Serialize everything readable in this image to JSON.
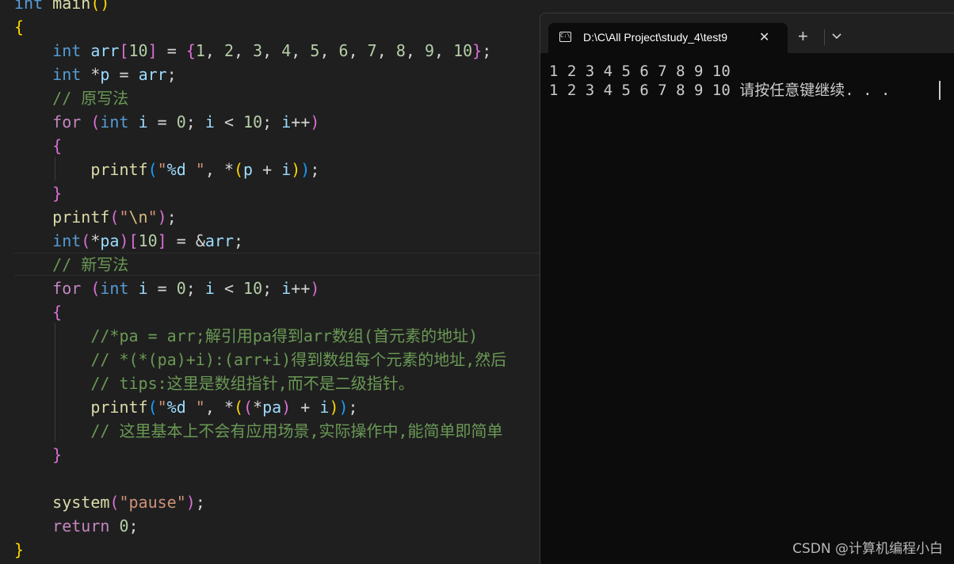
{
  "editor": {
    "lines": [
      [
        {
          "c": "kw",
          "t": "int"
        },
        {
          "t": " "
        },
        {
          "c": "fn",
          "t": "main"
        },
        {
          "c": "b1",
          "t": "()"
        }
      ],
      [
        {
          "c": "b1",
          "t": "{"
        }
      ],
      [
        {
          "t": "    "
        },
        {
          "c": "kw",
          "t": "int"
        },
        {
          "t": " "
        },
        {
          "c": "var",
          "t": "arr"
        },
        {
          "c": "b2",
          "t": "["
        },
        {
          "c": "num",
          "t": "10"
        },
        {
          "c": "b2",
          "t": "]"
        },
        {
          "t": " = "
        },
        {
          "c": "b2",
          "t": "{"
        },
        {
          "c": "num",
          "t": "1"
        },
        {
          "t": ", "
        },
        {
          "c": "num",
          "t": "2"
        },
        {
          "t": ", "
        },
        {
          "c": "num",
          "t": "3"
        },
        {
          "t": ", "
        },
        {
          "c": "num",
          "t": "4"
        },
        {
          "t": ", "
        },
        {
          "c": "num",
          "t": "5"
        },
        {
          "t": ", "
        },
        {
          "c": "num",
          "t": "6"
        },
        {
          "t": ", "
        },
        {
          "c": "num",
          "t": "7"
        },
        {
          "t": ", "
        },
        {
          "c": "num",
          "t": "8"
        },
        {
          "t": ", "
        },
        {
          "c": "num",
          "t": "9"
        },
        {
          "t": ", "
        },
        {
          "c": "num",
          "t": "10"
        },
        {
          "c": "b2",
          "t": "}"
        },
        {
          "t": ";"
        }
      ],
      [
        {
          "t": "    "
        },
        {
          "c": "kw",
          "t": "int"
        },
        {
          "t": " *"
        },
        {
          "c": "var",
          "t": "p"
        },
        {
          "t": " = "
        },
        {
          "c": "var",
          "t": "arr"
        },
        {
          "t": ";"
        }
      ],
      [
        {
          "t": "    "
        },
        {
          "c": "cmt",
          "t": "// 原写法"
        }
      ],
      [
        {
          "t": "    "
        },
        {
          "c": "flow",
          "t": "for"
        },
        {
          "t": " "
        },
        {
          "c": "b2",
          "t": "("
        },
        {
          "c": "kw",
          "t": "int"
        },
        {
          "t": " "
        },
        {
          "c": "var",
          "t": "i"
        },
        {
          "t": " = "
        },
        {
          "c": "num",
          "t": "0"
        },
        {
          "t": "; "
        },
        {
          "c": "var",
          "t": "i"
        },
        {
          "t": " < "
        },
        {
          "c": "num",
          "t": "10"
        },
        {
          "t": "; "
        },
        {
          "c": "var",
          "t": "i"
        },
        {
          "t": "++"
        },
        {
          "c": "b2",
          "t": ")"
        }
      ],
      [
        {
          "t": "    "
        },
        {
          "c": "b2",
          "t": "{"
        }
      ],
      [
        {
          "t": "        "
        },
        {
          "c": "fn",
          "t": "printf"
        },
        {
          "c": "b3",
          "t": "("
        },
        {
          "c": "str",
          "t": "\""
        },
        {
          "c": "var",
          "t": "%d"
        },
        {
          "c": "str",
          "t": " \""
        },
        {
          "t": ", *"
        },
        {
          "c": "b1",
          "t": "("
        },
        {
          "c": "var",
          "t": "p"
        },
        {
          "t": " + "
        },
        {
          "c": "var",
          "t": "i"
        },
        {
          "c": "b1",
          "t": ")"
        },
        {
          "c": "b3",
          "t": ")"
        },
        {
          "t": ";"
        }
      ],
      [
        {
          "t": "    "
        },
        {
          "c": "b2",
          "t": "}"
        }
      ],
      [
        {
          "t": "    "
        },
        {
          "c": "fn",
          "t": "printf"
        },
        {
          "c": "b2",
          "t": "("
        },
        {
          "c": "str",
          "t": "\""
        },
        {
          "c": "esc",
          "t": "\\n"
        },
        {
          "c": "str",
          "t": "\""
        },
        {
          "c": "b2",
          "t": ")"
        },
        {
          "t": ";"
        }
      ],
      [
        {
          "t": "    "
        },
        {
          "c": "kw",
          "t": "int"
        },
        {
          "c": "b2",
          "t": "("
        },
        {
          "t": "*"
        },
        {
          "c": "var",
          "t": "pa"
        },
        {
          "c": "b2",
          "t": ")"
        },
        {
          "c": "b2",
          "t": "["
        },
        {
          "c": "num",
          "t": "10"
        },
        {
          "c": "b2",
          "t": "]"
        },
        {
          "t": " = &"
        },
        {
          "c": "var",
          "t": "arr"
        },
        {
          "t": ";"
        }
      ],
      [
        {
          "t": "    "
        },
        {
          "c": "cmt",
          "t": "// 新写法"
        }
      ],
      [
        {
          "t": "    "
        },
        {
          "c": "flow",
          "t": "for"
        },
        {
          "t": " "
        },
        {
          "c": "b2",
          "t": "("
        },
        {
          "c": "kw",
          "t": "int"
        },
        {
          "t": " "
        },
        {
          "c": "var",
          "t": "i"
        },
        {
          "t": " = "
        },
        {
          "c": "num",
          "t": "0"
        },
        {
          "t": "; "
        },
        {
          "c": "var",
          "t": "i"
        },
        {
          "t": " < "
        },
        {
          "c": "num",
          "t": "10"
        },
        {
          "t": "; "
        },
        {
          "c": "var",
          "t": "i"
        },
        {
          "t": "++"
        },
        {
          "c": "b2",
          "t": ")"
        }
      ],
      [
        {
          "t": "    "
        },
        {
          "c": "b2",
          "t": "{"
        }
      ],
      [
        {
          "t": "        "
        },
        {
          "c": "cmt",
          "t": "//*pa = arr;解引用pa得到arr数组(首元素的地址)"
        }
      ],
      [
        {
          "t": "        "
        },
        {
          "c": "cmt",
          "t": "// *(*(pa)+i):(arr+i)得到数组每个元素的地址,然后"
        }
      ],
      [
        {
          "t": "        "
        },
        {
          "c": "cmt",
          "t": "// tips:这里是数组指针,而不是二级指针。"
        }
      ],
      [
        {
          "t": "        "
        },
        {
          "c": "fn",
          "t": "printf"
        },
        {
          "c": "b3",
          "t": "("
        },
        {
          "c": "str",
          "t": "\""
        },
        {
          "c": "var",
          "t": "%d"
        },
        {
          "c": "str",
          "t": " \""
        },
        {
          "t": ", *"
        },
        {
          "c": "b1",
          "t": "("
        },
        {
          "c": "b2",
          "t": "("
        },
        {
          "t": "*"
        },
        {
          "c": "var",
          "t": "pa"
        },
        {
          "c": "b2",
          "t": ")"
        },
        {
          "t": " + "
        },
        {
          "c": "var",
          "t": "i"
        },
        {
          "c": "b1",
          "t": ")"
        },
        {
          "c": "b3",
          "t": ")"
        },
        {
          "t": ";"
        }
      ],
      [
        {
          "t": "        "
        },
        {
          "c": "cmt",
          "t": "// 这里基本上不会有应用场景,实际操作中,能简单即简单"
        }
      ],
      [
        {
          "t": "    "
        },
        {
          "c": "b2",
          "t": "}"
        }
      ],
      [
        {
          "t": ""
        }
      ],
      [
        {
          "t": "    "
        },
        {
          "c": "fn",
          "t": "system"
        },
        {
          "c": "b2",
          "t": "("
        },
        {
          "c": "str",
          "t": "\"pause\""
        },
        {
          "c": "b2",
          "t": ")"
        },
        {
          "t": ";"
        }
      ],
      [
        {
          "t": "    "
        },
        {
          "c": "flow",
          "t": "return"
        },
        {
          "t": " "
        },
        {
          "c": "num",
          "t": "0"
        },
        {
          "t": ";"
        }
      ],
      [
        {
          "c": "b1",
          "t": "}"
        }
      ]
    ]
  },
  "terminal": {
    "tab_icon_text": "C:\\",
    "tab_title": "D:\\C\\All Project\\study_4\\test9",
    "close_glyph": "✕",
    "new_tab_glyph": "+",
    "output": [
      "1 2 3 4 5 6 7 8 9 10",
      "1 2 3 4 5 6 7 8 9 10 请按任意键继续. . ."
    ]
  },
  "watermark": "CSDN @计算机编程小白"
}
